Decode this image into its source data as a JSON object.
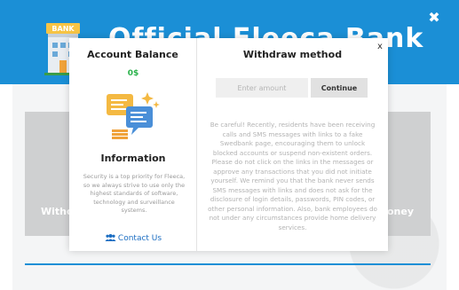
{
  "app": {
    "title": "Official Fleeca Bank",
    "logo_text": "BANK",
    "bg_left_label": "Withd",
    "bg_right_label": "oney"
  },
  "modal": {
    "close_label": "x",
    "left": {
      "title": "Account Balance",
      "balance": "0$",
      "info_title": "Information",
      "info_text": "Security is a top priority for Fleeca, so we always strive to use only the highest standards of software, technology and surveillance systems.",
      "contact_label": "Contact Us"
    },
    "right": {
      "title": "Withdraw method",
      "amount_placeholder": "Enter amount",
      "amount_value": "",
      "continue_label": "Continue",
      "warning": "Be careful! Recently, residents have been receiving calls and SMS messages with links to a fake Swedbank page, encouraging them to unlock blocked accounts or suspend non-existent orders. Please do not click on the links in the messages or approve any transactions that you did not initiate yourself. We remind you that the bank never sends SMS messages with links and does not ask for the disclosure of login details, passwords, PIN codes, or other personal information. Also, bank employees do not under any circumstances provide home delivery services."
    }
  },
  "colors": {
    "header_blue": "#1b8fd6",
    "balance_green": "#2bb24c",
    "link_blue": "#1b6dc2"
  },
  "icons": [
    "bank-building-icon",
    "chat-bubbles-icon",
    "users-icon",
    "close-icon"
  ]
}
